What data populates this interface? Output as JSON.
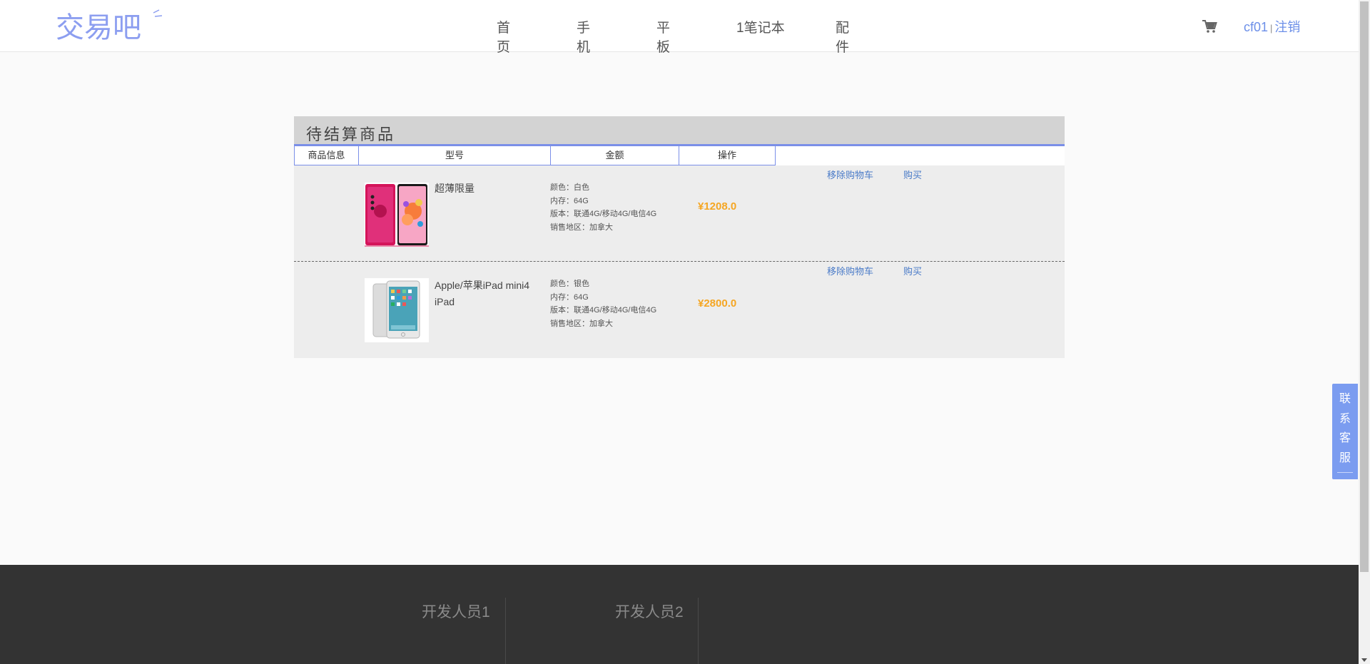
{
  "header": {
    "logo_text": "交易吧",
    "nav": [
      "首页",
      "手机",
      "平板",
      "1笔记本",
      "配件"
    ],
    "username": "cf01",
    "separator": "|",
    "logout": "注销"
  },
  "cart": {
    "title": "待结算商品",
    "columns": [
      "商品信息",
      "型号",
      "金额",
      "操作"
    ],
    "items": [
      {
        "name": "超薄限量",
        "specs": [
          "颜色：白色",
          "内存：64G",
          "版本：联通4G/移动4G/电信4G",
          "销售地区：加拿大"
        ],
        "price": "¥1208.0",
        "remove_label": "移除购物车",
        "buy_label": "购买"
      },
      {
        "name": "Apple/苹果iPad mini4 iPad",
        "specs": [
          "颜色：银色",
          "内存：64G",
          "版本：联通4G/移动4G/电信4G",
          "销售地区：加拿大"
        ],
        "price": "¥2800.0",
        "remove_label": "移除购物车",
        "buy_label": "购买"
      }
    ]
  },
  "service": [
    "联",
    "系",
    "客",
    "服"
  ],
  "footer": {
    "dev1": "开发人员1",
    "dev2": "开发人员2"
  },
  "colors": {
    "accent": "#7b8fe8",
    "price": "#f5a623",
    "link": "#4a7bc8",
    "footer_bg": "#333333"
  }
}
